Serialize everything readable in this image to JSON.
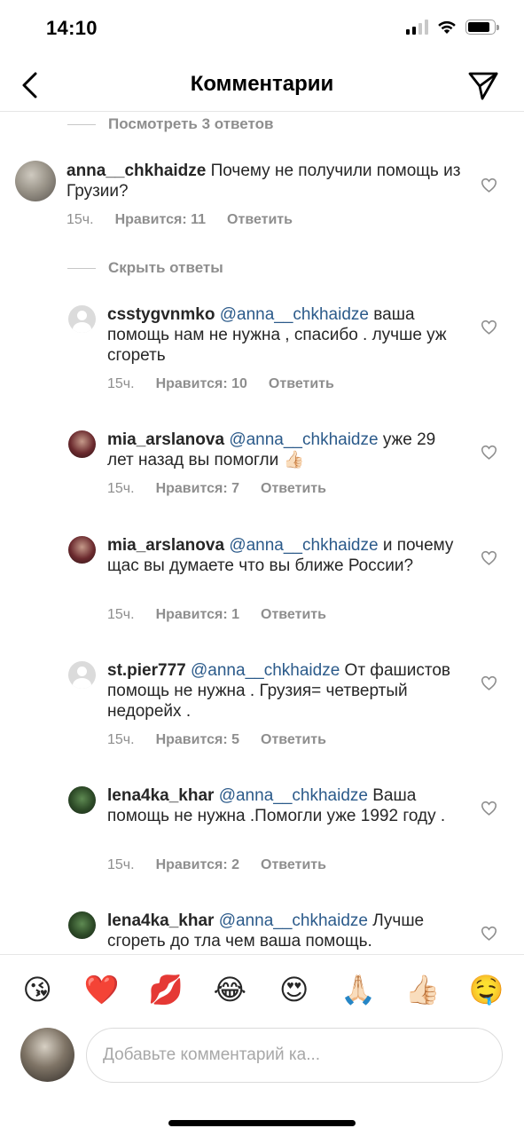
{
  "status_bar": {
    "time": "14:10"
  },
  "nav": {
    "title": "Комментарии"
  },
  "thread": {
    "view_replies_label": "Посмотреть 3 ответов",
    "hide_replies_label": "Скрыть ответы",
    "main_comment": {
      "username": "anna__chkhaidze",
      "text": "Почему не получили помощь из Грузии?",
      "time": "15ч.",
      "likes": "Нравится: 11",
      "reply_label": "Ответить"
    },
    "replies": [
      {
        "username": "csstygvnmko",
        "mention": "@anna__chkhaidze",
        "text": "ваша помощь нам не нужна , спасибо . лучше уж сгореть",
        "time": "15ч.",
        "likes": "Нравится: 10",
        "reply_label": "Ответить"
      },
      {
        "username": "mia_arslanova",
        "mention": "@anna__chkhaidze",
        "text": "уже 29 лет назад вы помогли 👍🏻",
        "time": "15ч.",
        "likes": "Нравится: 7",
        "reply_label": "Ответить"
      },
      {
        "username": "mia_arslanova",
        "mention": "@anna__chkhaidze",
        "text": "и почему щас вы думаете что вы ближе России?",
        "time": "15ч.",
        "likes": "Нравится: 1",
        "reply_label": "Ответить"
      },
      {
        "username": "st.pier777",
        "mention": "@anna__chkhaidze",
        "text": "От фашистов помощь не нужна . Грузия= четвертый недорейх .",
        "time": "15ч.",
        "likes": "Нравится: 5",
        "reply_label": "Ответить"
      },
      {
        "username": "lena4ka_khar",
        "mention": "@anna__chkhaidze",
        "text": "Ваша помощь не нужна .Помогли уже 1992 году .",
        "time": "15ч.",
        "likes": "Нравится: 2",
        "reply_label": "Ответить"
      },
      {
        "username": "lena4ka_khar",
        "mention": "@anna__chkhaidze",
        "text": "Лучше сгореть до тла чем ваша помощь.",
        "time": "",
        "likes": "",
        "reply_label": ""
      }
    ]
  },
  "emoji_bar": [
    "😘",
    "❤️",
    "💋",
    "😂",
    "😍",
    "🙏🏻",
    "👍🏻",
    "🤤"
  ],
  "composer": {
    "placeholder": "Добавьте комментарий ка..."
  },
  "colors": {
    "mention": "#2b5a8a",
    "secondary_text": "#8e8e8e",
    "divider": "#e6e6e6"
  }
}
